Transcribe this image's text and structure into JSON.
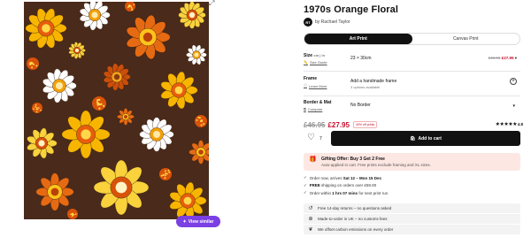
{
  "product": {
    "title": "1970s Orange Floral",
    "artist_avatar": "RT",
    "artist": "by Rachael Taylor"
  },
  "tabs": [
    {
      "label": "Art Print",
      "active": true
    },
    {
      "label": "Canvas Print",
      "active": false
    }
  ],
  "size": {
    "label": "Size",
    "unit_toggle": "cm | in",
    "guide": "Size Guide",
    "value": "23 × 30cm",
    "old_price": "£46.95",
    "new_price": "£27.95"
  },
  "frame": {
    "label": "Frame",
    "learn_more": "Learn More",
    "title": "Add a handmade frame",
    "sub": "3 options available"
  },
  "border": {
    "label": "Border & Mat",
    "compare": "Compare",
    "value": "No Border"
  },
  "price": {
    "old": "£46.95",
    "new": "£27.95",
    "badge": "40% off prints",
    "stars": "★★★★★",
    "rating": "4.8"
  },
  "cart": {
    "likes": "7",
    "button": "Add to cart"
  },
  "gift": {
    "title": "Gifting Offer: Buy 3 Get 2 Free",
    "sub": "Auto-applied in cart. Free prints exclude framing and XL sizes."
  },
  "delivery": [
    {
      "pre": "Order now, arrives ",
      "bold": "Sat 12 – Mon 15 Dec",
      "post": ""
    },
    {
      "pre": "",
      "bold": "FREE",
      "post": " shipping on orders over £59.00"
    },
    {
      "pre": "Order within ",
      "bold": "1 hrs 07 mins",
      "post": " for next print run"
    }
  ],
  "perks": [
    {
      "icon": "return-icon",
      "text": "Free 14-day returns – no questions asked"
    },
    {
      "icon": "uk-flag-icon",
      "text": "Made-to-order in UK – no customs fees"
    },
    {
      "icon": "leaf-icon",
      "text": "We offset carbon emissions on every order"
    }
  ],
  "view_similar": "View similar",
  "colors": {
    "accent": "#c8102e",
    "button": "#111111",
    "view_similar": "#7b3fe4",
    "gift_bg": "#fde7e3",
    "art_bg": "#4a2a1a"
  }
}
